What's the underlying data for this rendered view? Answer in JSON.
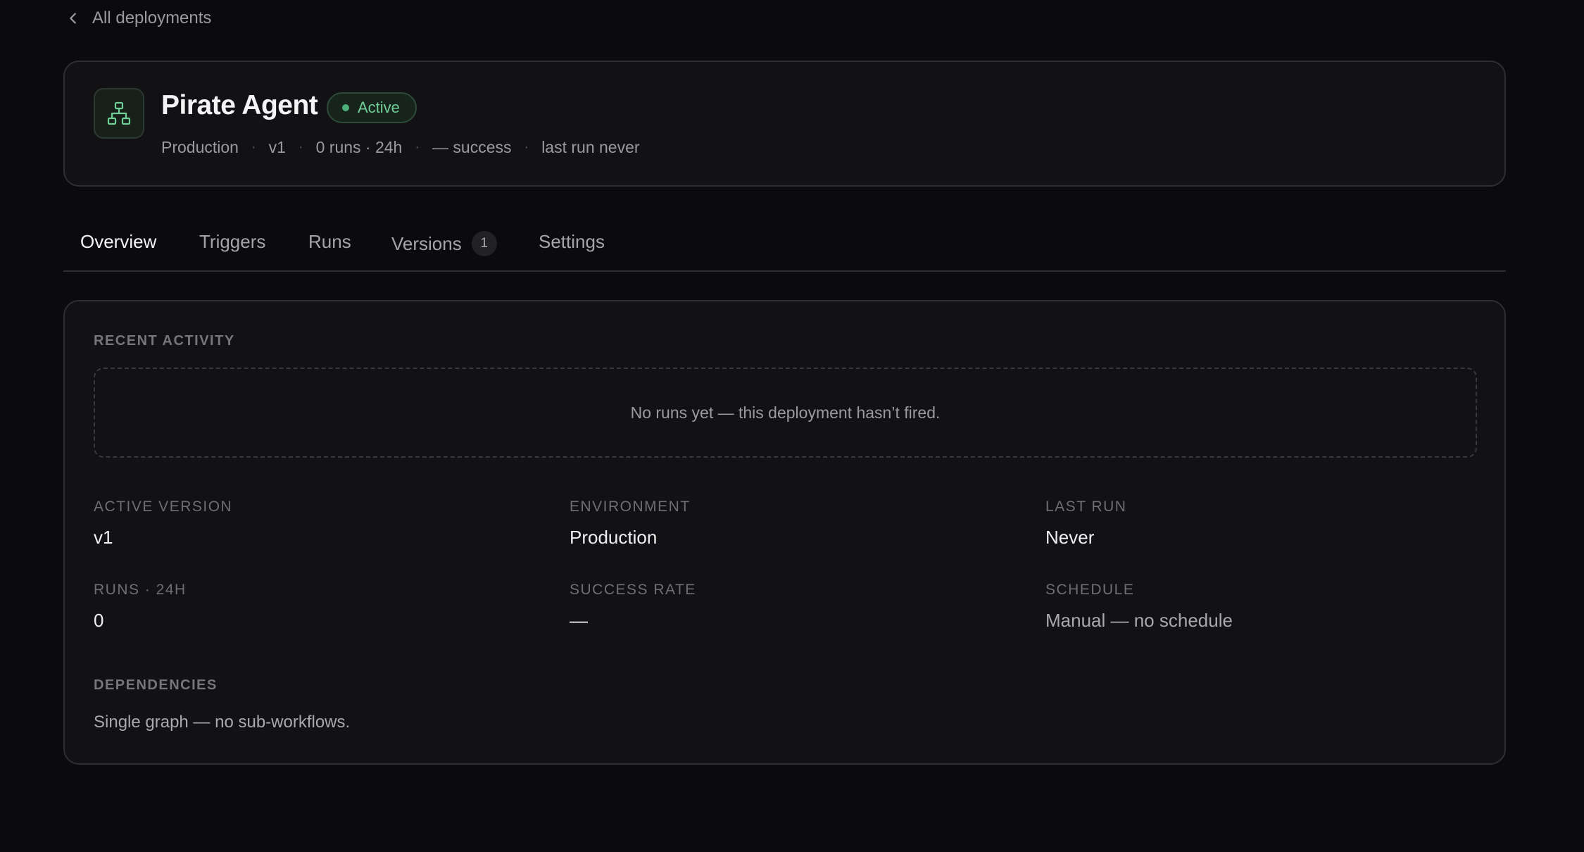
{
  "nav": {
    "back_label": "All deployments"
  },
  "agent": {
    "title": "Pirate Agent",
    "status": "Active",
    "meta": {
      "environment": "Production",
      "version": "v1",
      "runs": "0 runs · 24h",
      "success": "— success",
      "last_run": "last run never"
    }
  },
  "tabs": [
    {
      "label": "Overview"
    },
    {
      "label": "Triggers"
    },
    {
      "label": "Runs"
    },
    {
      "label": "Versions",
      "count": "1"
    },
    {
      "label": "Settings"
    }
  ],
  "overview": {
    "recent_activity_label": "RECENT ACTIVITY",
    "empty_message": "No runs yet — this deployment hasn’t fired.",
    "stats": {
      "active_version": {
        "label": "ACTIVE VERSION",
        "value": "v1"
      },
      "environment": {
        "label": "ENVIRONMENT",
        "value": "Production"
      },
      "last_run": {
        "label": "LAST RUN",
        "value": "Never"
      },
      "runs_24h": {
        "label": "RUNS · 24H",
        "value": "0"
      },
      "success_rate": {
        "label": "SUCCESS RATE",
        "value": "—"
      },
      "schedule": {
        "label": "SCHEDULE",
        "value": "Manual — no schedule"
      }
    },
    "dependencies_label": "DEPENDENCIES",
    "dependencies_text": "Single graph — no sub-workflows."
  },
  "colors": {
    "background": "#0b0b0d",
    "card": "#121214",
    "accent_green": "#6fcf97"
  },
  "icons": {
    "back": "chevron-left-icon",
    "agent": "workflow-graph-icon"
  }
}
